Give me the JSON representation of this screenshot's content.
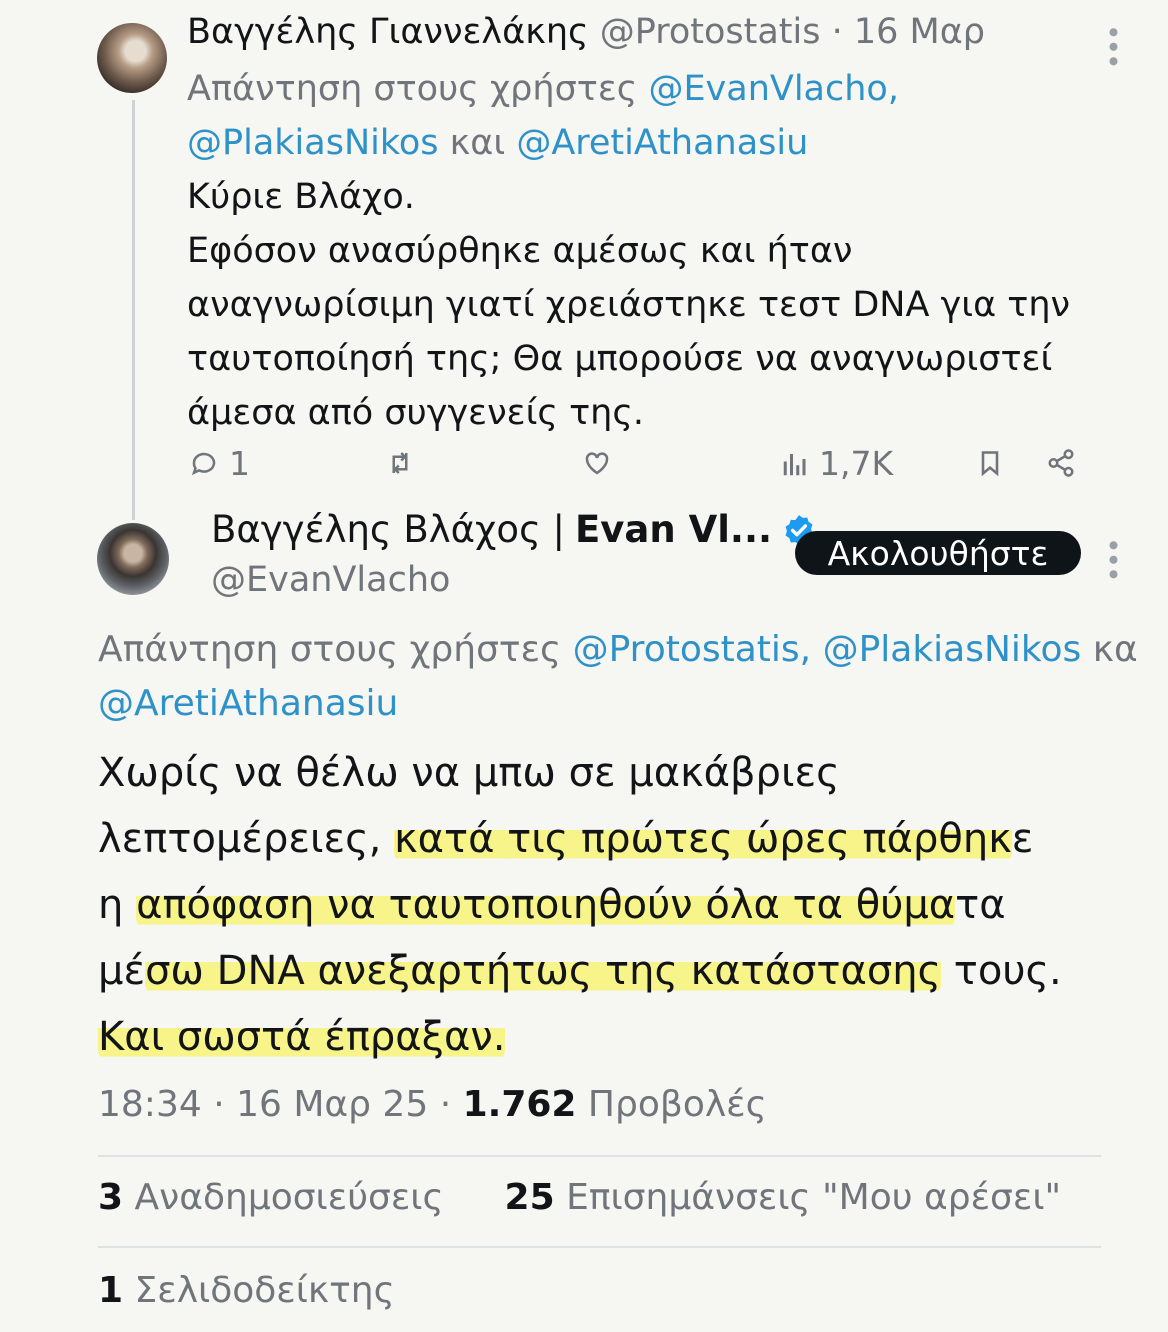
{
  "reply_tweet": {
    "author_name": "Βαγγέλης Γιαννελάκης",
    "handle": "@Protostatis",
    "separator": " · ",
    "date": "16 Μαρ",
    "reply_prefix": "Απάντηση στους χρήστες ",
    "reply_mention_1": "@EvanVlacho,",
    "reply_mention_2": "@PlakiasNikos",
    "reply_and": " και ",
    "reply_mention_3": "@AretiAthanasiu",
    "text_lines": [
      "Κύριε Βλάχο.",
      "Εφόσον ανασύρθηκε αμέσως και ήταν",
      "αναγνωρίσιμη γιατί χρειάστηκε τεστ DNA για την",
      "ταυτοποίησή της; Θα μπορούσε να αναγνωριστεί",
      "άμεσα από συγγενείς της."
    ],
    "actions": {
      "reply_count": "1",
      "views_count": "1,7K"
    }
  },
  "main_tweet": {
    "author_name_plain": "Βαγγέλης Βλάχος |",
    "author_name_bold": "Evan Vl...",
    "handle": "@EvanVlacho",
    "follow_label": "Ακολουθήστε",
    "verified_color": "#1d9bf0",
    "reply_prefix": "Απάντηση στους χρήστες ",
    "reply_mention_1": "@Protostatis,",
    "reply_mention_2": "@PlakiasNikos",
    "reply_and": " κα",
    "reply_mention_3": "@AretiAthanasiu",
    "text": {
      "line1": "Χωρίς να θέλω να μπω σε μακάβριες",
      "line2_pre": "λεπτομέρειες, ",
      "line2_hl": "κατά τις πρώτες ώρες πάρθηκ",
      "line2_post": "ε",
      "line3_pre": "η ",
      "line3_hl": "απόφαση να ταυτοποιηθούν όλα τα θύμα",
      "line3_post": "τα",
      "line4_pre": "μέ",
      "line4_hl": "σω DNA ανεξαρτήτως της κατάστασης",
      "line4_post": " τους.",
      "line5_hl": "Και σωστά έπραξαν."
    },
    "time": "18:34",
    "date": "16 Μαρ 25",
    "meta_separator": " · ",
    "views_count": "1.762",
    "views_label": " Προβολές",
    "reposts_count": "3",
    "reposts_label": " Αναδημοσιεύσεις",
    "likes_count": "25",
    "likes_label": " Επισημάνσεις \"Μου αρέσει\"",
    "bookmarks_count": "1",
    "bookmarks_label": " Σελιδοδείκτης"
  }
}
